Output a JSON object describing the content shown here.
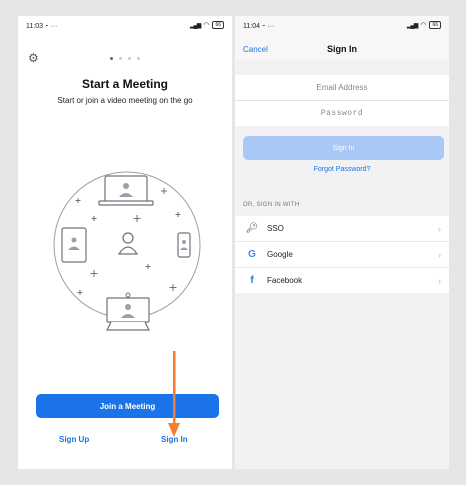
{
  "left": {
    "status_time": "11:03",
    "status_extra": "⁃ ···",
    "battery": "66",
    "title": "Start a Meeting",
    "subtitle": "Start or join a video meeting on the go",
    "join_label": "Join a Meeting",
    "signup_label": "Sign Up",
    "signin_label": "Sign In",
    "accent": "#1a73e8",
    "arrow_color": "#f47d30"
  },
  "right": {
    "status_time": "11:04",
    "status_extra": "⁃ ···",
    "battery": "66",
    "cancel_label": "Cancel",
    "title": "Sign In",
    "email_placeholder": "Email Address",
    "password_placeholder": "Password",
    "signin_button": "Sign In",
    "forgot_label": "Forgot Password?",
    "or_label": "OR, SIGN IN WITH",
    "options": [
      {
        "label": "SSO",
        "icon": "key-icon"
      },
      {
        "label": "Google",
        "icon": "google-icon"
      },
      {
        "label": "Facebook",
        "icon": "facebook-icon"
      }
    ]
  }
}
